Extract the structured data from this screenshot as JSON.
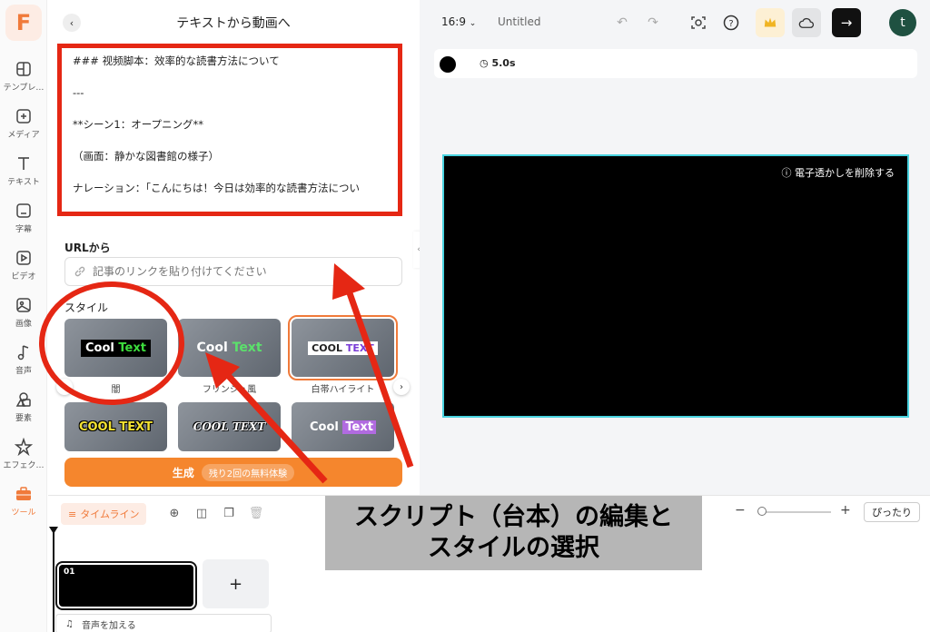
{
  "app": {
    "logo_letter": "F",
    "accent": "#f07a3a"
  },
  "sidebar": {
    "items": [
      {
        "label": "テンプレ…",
        "icon": "template-icon"
      },
      {
        "label": "メディア",
        "icon": "media-add-icon"
      },
      {
        "label": "テキスト",
        "icon": "text-icon"
      },
      {
        "label": "字幕",
        "icon": "subtitle-icon"
      },
      {
        "label": "ビデオ",
        "icon": "video-icon"
      },
      {
        "label": "画像",
        "icon": "image-icon"
      },
      {
        "label": "音声",
        "icon": "music-icon"
      },
      {
        "label": "要素",
        "icon": "shapes-icon"
      },
      {
        "label": "エフェク…",
        "icon": "effects-icon"
      },
      {
        "label": "ツール",
        "icon": "toolbox-icon"
      }
    ]
  },
  "panel": {
    "title": "テキストから動画へ",
    "script_lines": [
      "### 视频脚本：效率的な読書方法について",
      "---",
      "**シーン1：オープニング**",
      "（画面：静かな図書館の様子）",
      "ナレーション：「こんにちは！今日は効率的な読書方法につい"
    ],
    "url_label": "URLから",
    "url_placeholder": "記事のリンクを貼り付けてください",
    "style_label": "スタイル",
    "styles": [
      {
        "name": "闇",
        "text_a": "Cool",
        "text_b": "Text"
      },
      {
        "name": "フリンジュ風",
        "text_a": "Cool",
        "text_b": "Text"
      },
      {
        "name": "白帯ハイライト",
        "text_a": "COOL",
        "text_b": "TEXT"
      },
      {
        "name": "",
        "text_a": "COOL TEXT",
        "text_b": ""
      },
      {
        "name": "",
        "text_a": "COOL TEXT",
        "text_b": ""
      },
      {
        "name": "",
        "text_a": "Cool",
        "text_b": "Text"
      }
    ],
    "selected_style_index": 2,
    "generate_label": "生成",
    "generate_badge": "残り2回の無料体験"
  },
  "topbar": {
    "aspect_ratio": "16:9",
    "project_title": "Untitled",
    "avatar_letter": "t"
  },
  "canvas": {
    "duration": "5.0s",
    "fill_color": "#000000",
    "watermark_label": "電子透かしを削除する"
  },
  "timeline": {
    "label": "タイムライン",
    "clip_number": "01",
    "add_clip": "+",
    "add_audio": "音声を加える",
    "fit_label": "ぴったり"
  },
  "annotation": {
    "caption_line1": "スクリプト（台本）の編集と",
    "caption_line2": "スタイルの選択",
    "highlight_color": "#e52714"
  }
}
